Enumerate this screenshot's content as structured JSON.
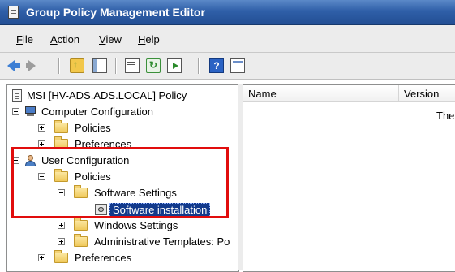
{
  "window": {
    "title": "Group Policy Management Editor"
  },
  "menu": [
    "File",
    "Action",
    "View",
    "Help"
  ],
  "toolbar": {
    "icons": [
      "back-icon",
      "forward-icon",
      "up-folder-icon",
      "show-hide-tree-icon",
      "properties-icon",
      "refresh-icon",
      "export-list-icon",
      "help-icon",
      "view-icon"
    ]
  },
  "tree": {
    "root": "MSI [HV-ADS.ADS.LOCAL] Policy",
    "computer_config": "Computer Configuration",
    "cc_policies": "Policies",
    "cc_preferences": "Preferences",
    "user_config": "User Configuration",
    "uc_policies": "Policies",
    "software_settings": "Software Settings",
    "software_installation": "Software installation",
    "windows_settings": "Windows Settings",
    "admin_templates": "Administrative Templates: Po",
    "uc_preferences": "Preferences"
  },
  "details": {
    "columns": [
      "Name",
      "Version"
    ],
    "empty_message": "The"
  },
  "colors": {
    "highlight": "#e10d0d",
    "selection": "#123a8c",
    "titlebar": "#2f5fa8"
  }
}
